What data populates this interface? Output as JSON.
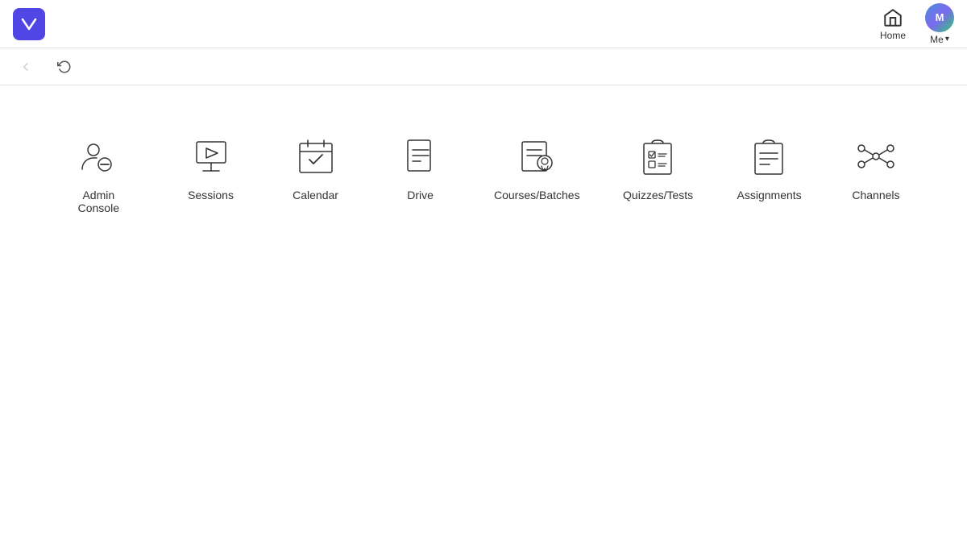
{
  "header": {
    "logo_alt": "Woden logo",
    "nav_home_label": "Home",
    "nav_me_label": "Me"
  },
  "toolbar": {
    "back_label": "back",
    "refresh_label": "refresh"
  },
  "grid": {
    "items": [
      {
        "id": "admin-console",
        "label": "Admin Console",
        "icon": "admin"
      },
      {
        "id": "sessions",
        "label": "Sessions",
        "icon": "sessions"
      },
      {
        "id": "calendar",
        "label": "Calendar",
        "icon": "calendar"
      },
      {
        "id": "drive",
        "label": "Drive",
        "icon": "drive"
      },
      {
        "id": "courses-batches",
        "label": "Courses/Batches",
        "icon": "courses"
      },
      {
        "id": "quizzes-tests",
        "label": "Quizzes/Tests",
        "icon": "quizzes"
      },
      {
        "id": "assignments",
        "label": "Assignments",
        "icon": "assignments"
      },
      {
        "id": "channels",
        "label": "Channels",
        "icon": "channels"
      }
    ]
  }
}
